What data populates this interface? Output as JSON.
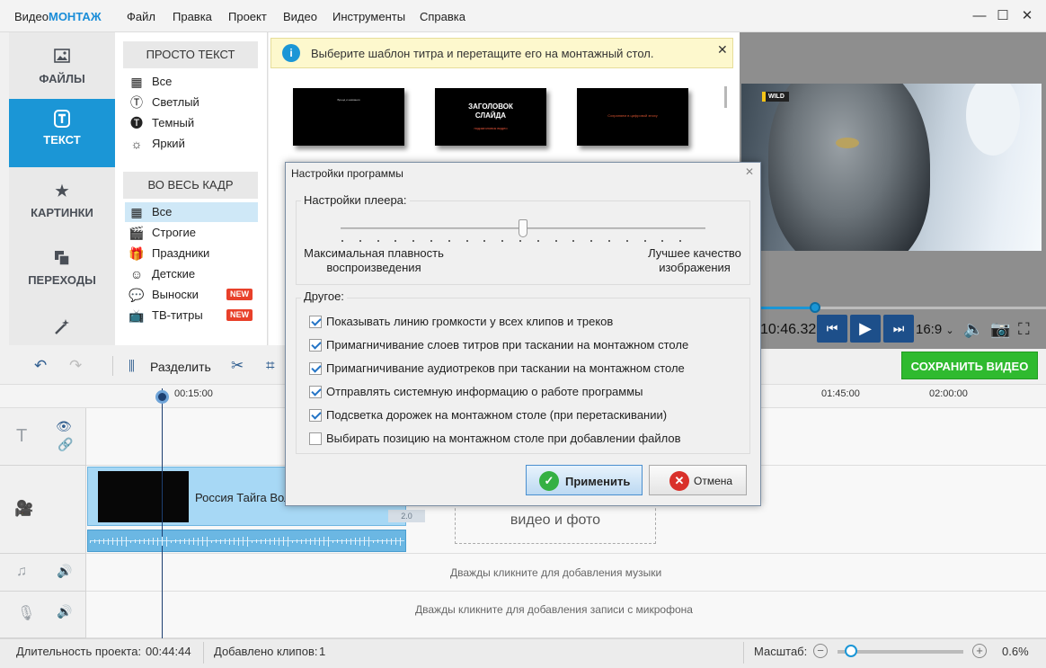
{
  "app": {
    "title_prefix": "Видео",
    "title_brand": "МОНТАЖ"
  },
  "menu": [
    "Файл",
    "Правка",
    "Проект",
    "Видео",
    "Инструменты",
    "Справка"
  ],
  "window_controls": {
    "minimize": "—",
    "maximize": "☐",
    "close": "✕"
  },
  "sidebar": {
    "items": [
      {
        "label": "ФАЙЛЫ",
        "icon": "image-icon"
      },
      {
        "label": "ТЕКСТ",
        "icon": "text-icon",
        "active": true
      },
      {
        "label": "КАРТИНКИ",
        "icon": "star-icon"
      },
      {
        "label": "ПЕРЕХОДЫ",
        "icon": "transitions-icon"
      },
      {
        "label": "",
        "icon": "magic-wand-icon"
      }
    ]
  },
  "categories": {
    "group1_header": "ПРОСТО ТЕКСТ",
    "group1": [
      "Все",
      "Светлый",
      "Темный",
      "Яркий"
    ],
    "group2_header": "ВО ВЕСЬ КАДР",
    "group2": [
      "Все",
      "Строгие",
      "Праздники",
      "Детские",
      "Выноски",
      "ТВ-титры"
    ],
    "new_badge": "NEW"
  },
  "info_bar": {
    "text": "Выберите шаблон титра и перетащите его на монтажный стол."
  },
  "templates": [
    {
      "name": "template-credits",
      "text": "Бренд и названия"
    },
    {
      "name": "template-heading",
      "line1": "ЗАГОЛОВОК",
      "line2": "СЛАЙДА",
      "sub": "подзаголовок видео"
    },
    {
      "name": "template-red",
      "text": "Сохраняем в цифровой эпоху"
    }
  ],
  "preview": {
    "badge": "WILD",
    "timecode": "10:46.325",
    "aspect": "16:9",
    "progress_fraction": 0.25
  },
  "toolbar": {
    "split_label": "Разделить",
    "save_label": "СОХРАНИТЬ ВИДЕО"
  },
  "ruler": {
    "ticks": [
      "00:15:00",
      "01:45:00",
      "02:00:00"
    ]
  },
  "timeline": {
    "clip_title": "Россия Тайга Вол",
    "clip_speed": "2.0",
    "drop_hint": "видео и фото",
    "music_hint": "Дважды кликните для добавления музыки",
    "mic_hint": "Дважды кликните для добавления записи с микрофона"
  },
  "status": {
    "duration_label": "Длительность проекта:",
    "duration_value": "00:44:44",
    "clips_label": "Добавлено клипов:",
    "clips_value": "1",
    "zoom_label": "Масштаб:",
    "zoom_value": "0.6%",
    "zoom_minus": "−",
    "zoom_plus": "+"
  },
  "dialog": {
    "title": "Настройки программы",
    "close": "✕",
    "player_group": "Настройки плеера:",
    "slider_left": "Максимальная плавность воспроизведения",
    "slider_right": "Лучшее качество изображения",
    "slider_fraction": 0.5,
    "other_group": "Другое:",
    "options": [
      {
        "label": "Показывать линию громкости у всех клипов и треков",
        "checked": true
      },
      {
        "label": "Примагничивание слоев титров при таскании на монтажном столе",
        "checked": true
      },
      {
        "label": "Примагничивание аудиотреков при таскании на монтажном столе",
        "checked": true
      },
      {
        "label": "Отправлять системную информацию о работе программы",
        "checked": true
      },
      {
        "label": "Подсветка дорожек на монтажном столе (при перетаскивании)",
        "checked": true
      },
      {
        "label": "Выбирать позицию на монтажном столе при добавлении файлов",
        "checked": false
      }
    ],
    "apply": "Применить",
    "cancel": "Отмена"
  },
  "colors": {
    "accent": "#1b96d6",
    "save": "#2fba2f",
    "new_badge": "#e8402a"
  }
}
